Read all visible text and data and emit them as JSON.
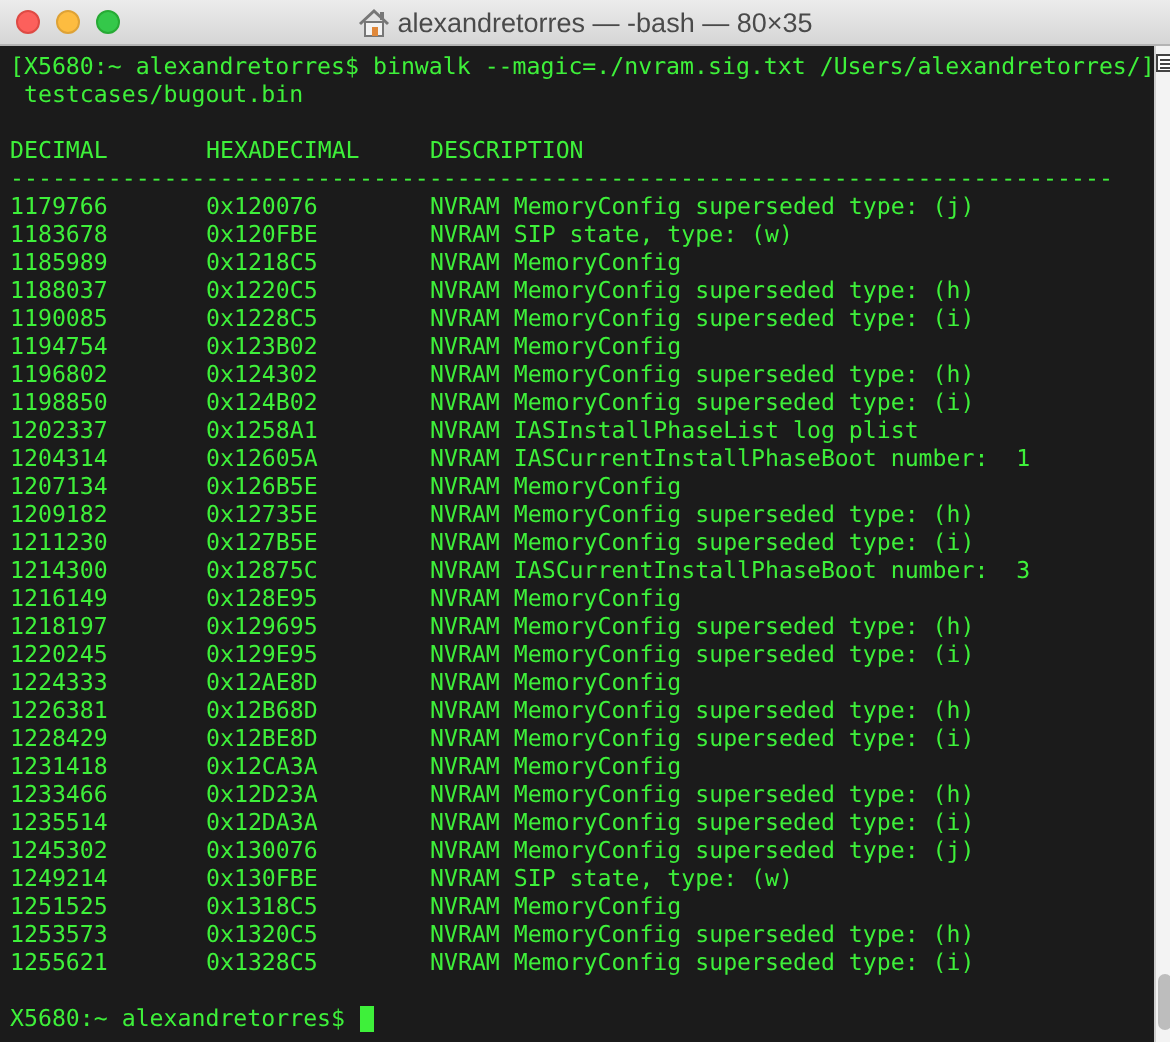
{
  "window": {
    "title": "alexandretorres — -bash — 80×35"
  },
  "terminal": {
    "lines": [
      {
        "kind": "text",
        "text": "[X5680:~ alexandretorres$ binwalk --magic=./nvram.sig.txt /Users/alexandretorres/]"
      },
      {
        "kind": "text",
        "text": " testcases/bugout.bin"
      },
      {
        "kind": "blank"
      },
      {
        "kind": "header",
        "cells": [
          "DECIMAL",
          "HEXADECIMAL",
          "DESCRIPTION"
        ]
      },
      {
        "kind": "rule",
        "text": "-------------------------------------------------------------------------------"
      },
      {
        "kind": "row",
        "cells": [
          "1179766",
          "0x120076",
          "NVRAM MemoryConfig superseded type: (j)"
        ]
      },
      {
        "kind": "row",
        "cells": [
          "1183678",
          "0x120FBE",
          "NVRAM SIP state, type: (w)"
        ]
      },
      {
        "kind": "row",
        "cells": [
          "1185989",
          "0x1218C5",
          "NVRAM MemoryConfig"
        ]
      },
      {
        "kind": "row",
        "cells": [
          "1188037",
          "0x1220C5",
          "NVRAM MemoryConfig superseded type: (h)"
        ]
      },
      {
        "kind": "row",
        "cells": [
          "1190085",
          "0x1228C5",
          "NVRAM MemoryConfig superseded type: (i)"
        ]
      },
      {
        "kind": "row",
        "cells": [
          "1194754",
          "0x123B02",
          "NVRAM MemoryConfig"
        ]
      },
      {
        "kind": "row",
        "cells": [
          "1196802",
          "0x124302",
          "NVRAM MemoryConfig superseded type: (h)"
        ]
      },
      {
        "kind": "row",
        "cells": [
          "1198850",
          "0x124B02",
          "NVRAM MemoryConfig superseded type: (i)"
        ]
      },
      {
        "kind": "row",
        "cells": [
          "1202337",
          "0x1258A1",
          "NVRAM IASInstallPhaseList log plist"
        ]
      },
      {
        "kind": "row",
        "cells": [
          "1204314",
          "0x12605A",
          "NVRAM IASCurrentInstallPhaseBoot number:  1"
        ]
      },
      {
        "kind": "row",
        "cells": [
          "1207134",
          "0x126B5E",
          "NVRAM MemoryConfig"
        ]
      },
      {
        "kind": "row",
        "cells": [
          "1209182",
          "0x12735E",
          "NVRAM MemoryConfig superseded type: (h)"
        ]
      },
      {
        "kind": "row",
        "cells": [
          "1211230",
          "0x127B5E",
          "NVRAM MemoryConfig superseded type: (i)"
        ]
      },
      {
        "kind": "row",
        "cells": [
          "1214300",
          "0x12875C",
          "NVRAM IASCurrentInstallPhaseBoot number:  3"
        ]
      },
      {
        "kind": "row",
        "cells": [
          "1216149",
          "0x128E95",
          "NVRAM MemoryConfig"
        ]
      },
      {
        "kind": "row",
        "cells": [
          "1218197",
          "0x129695",
          "NVRAM MemoryConfig superseded type: (h)"
        ]
      },
      {
        "kind": "row",
        "cells": [
          "1220245",
          "0x129E95",
          "NVRAM MemoryConfig superseded type: (i)"
        ]
      },
      {
        "kind": "row",
        "cells": [
          "1224333",
          "0x12AE8D",
          "NVRAM MemoryConfig"
        ]
      },
      {
        "kind": "row",
        "cells": [
          "1226381",
          "0x12B68D",
          "NVRAM MemoryConfig superseded type: (h)"
        ]
      },
      {
        "kind": "row",
        "cells": [
          "1228429",
          "0x12BE8D",
          "NVRAM MemoryConfig superseded type: (i)"
        ]
      },
      {
        "kind": "row",
        "cells": [
          "1231418",
          "0x12CA3A",
          "NVRAM MemoryConfig"
        ]
      },
      {
        "kind": "row",
        "cells": [
          "1233466",
          "0x12D23A",
          "NVRAM MemoryConfig superseded type: (h)"
        ]
      },
      {
        "kind": "row",
        "cells": [
          "1235514",
          "0x12DA3A",
          "NVRAM MemoryConfig superseded type: (i)"
        ]
      },
      {
        "kind": "row",
        "cells": [
          "1245302",
          "0x130076",
          "NVRAM MemoryConfig superseded type: (j)"
        ]
      },
      {
        "kind": "row",
        "cells": [
          "1249214",
          "0x130FBE",
          "NVRAM SIP state, type: (w)"
        ]
      },
      {
        "kind": "row",
        "cells": [
          "1251525",
          "0x1318C5",
          "NVRAM MemoryConfig"
        ]
      },
      {
        "kind": "row",
        "cells": [
          "1253573",
          "0x1320C5",
          "NVRAM MemoryConfig superseded type: (h)"
        ]
      },
      {
        "kind": "row",
        "cells": [
          "1255621",
          "0x1328C5",
          "NVRAM MemoryConfig superseded type: (i)"
        ]
      },
      {
        "kind": "blank"
      },
      {
        "kind": "prompt",
        "text": "X5680:~ alexandretorres$",
        "cursor": true
      }
    ]
  }
}
